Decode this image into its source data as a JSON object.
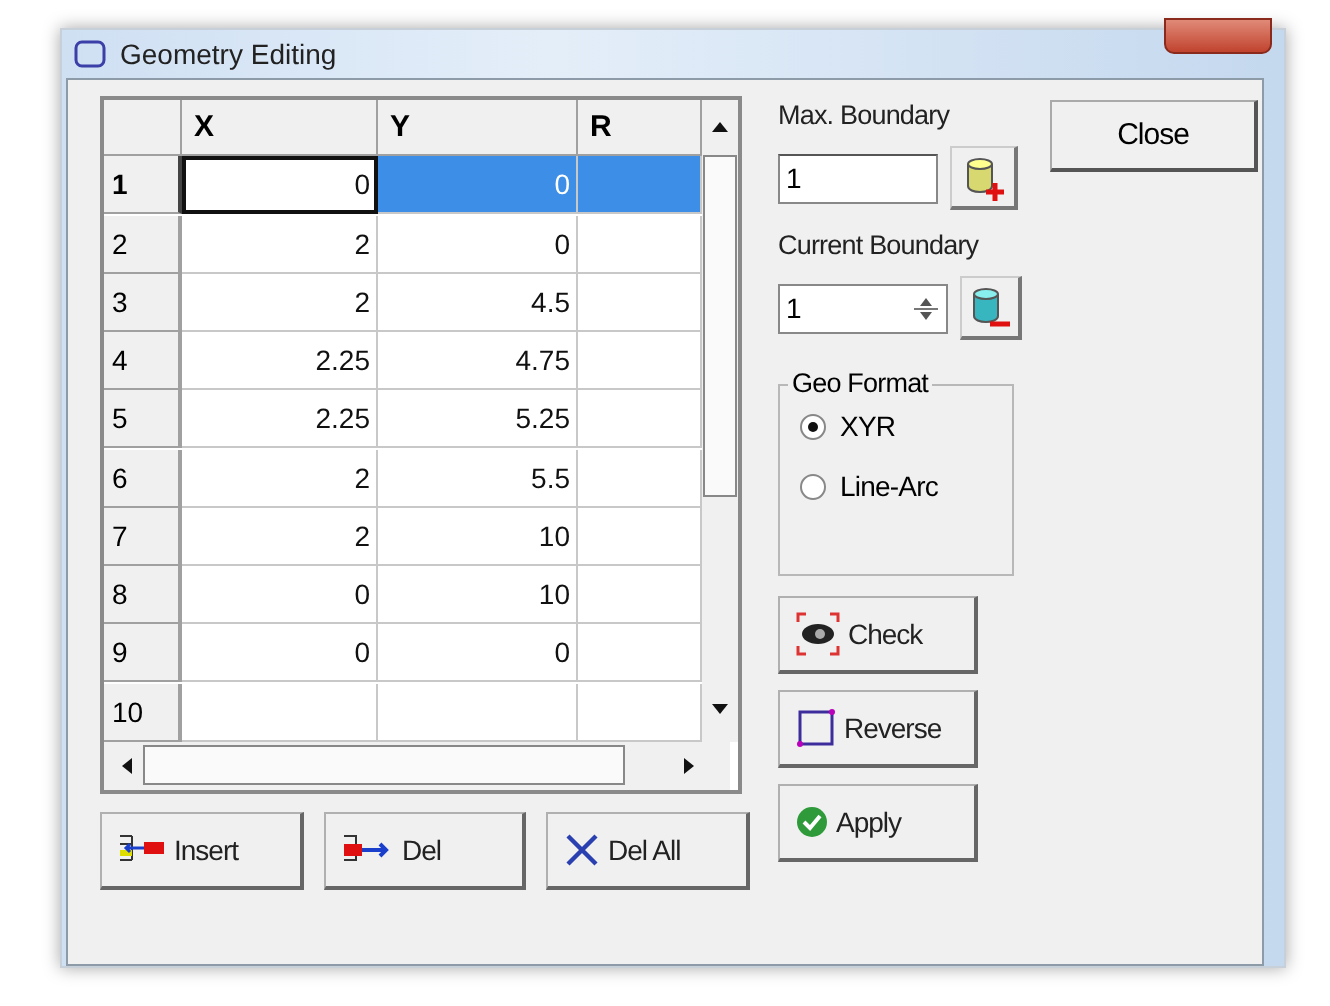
{
  "window": {
    "title": "Geometry Editing"
  },
  "grid": {
    "columns": [
      "X",
      "Y",
      "R"
    ],
    "rows": [
      {
        "header": "1",
        "selected": true,
        "cells": [
          {
            "text": "0",
            "selected": false,
            "focused": true
          },
          {
            "text": "0",
            "selected": true,
            "focused": false
          },
          {
            "text": "",
            "selected": true,
            "focused": false
          }
        ]
      },
      {
        "header": "2",
        "selected": false,
        "cells": [
          {
            "text": "2",
            "selected": false,
            "focused": false
          },
          {
            "text": "0",
            "selected": false,
            "focused": false
          },
          {
            "text": "",
            "selected": false,
            "focused": false
          }
        ]
      },
      {
        "header": "3",
        "selected": false,
        "cells": [
          {
            "text": "2",
            "selected": false,
            "focused": false
          },
          {
            "text": "4.5",
            "selected": false,
            "focused": false
          },
          {
            "text": "",
            "selected": false,
            "focused": false
          }
        ]
      },
      {
        "header": "4",
        "selected": false,
        "cells": [
          {
            "text": "2.25",
            "selected": false,
            "focused": false
          },
          {
            "text": "4.75",
            "selected": false,
            "focused": false
          },
          {
            "text": "",
            "selected": false,
            "focused": false
          }
        ]
      },
      {
        "header": "5",
        "selected": false,
        "cells": [
          {
            "text": "2.25",
            "selected": false,
            "focused": false
          },
          {
            "text": "5.25",
            "selected": false,
            "focused": false
          },
          {
            "text": "",
            "selected": false,
            "focused": false
          }
        ]
      },
      {
        "header": "6",
        "selected": false,
        "cells": [
          {
            "text": "2",
            "selected": false,
            "focused": false
          },
          {
            "text": "5.5",
            "selected": false,
            "focused": false
          },
          {
            "text": "",
            "selected": false,
            "focused": false
          }
        ]
      },
      {
        "header": "7",
        "selected": false,
        "cells": [
          {
            "text": "2",
            "selected": false,
            "focused": false
          },
          {
            "text": "10",
            "selected": false,
            "focused": false
          },
          {
            "text": "",
            "selected": false,
            "focused": false
          }
        ]
      },
      {
        "header": "8",
        "selected": false,
        "cells": [
          {
            "text": "0",
            "selected": false,
            "focused": false
          },
          {
            "text": "10",
            "selected": false,
            "focused": false
          },
          {
            "text": "",
            "selected": false,
            "focused": false
          }
        ]
      },
      {
        "header": "9",
        "selected": false,
        "cells": [
          {
            "text": "0",
            "selected": false,
            "focused": false
          },
          {
            "text": "0",
            "selected": false,
            "focused": false
          },
          {
            "text": "",
            "selected": false,
            "focused": false
          }
        ]
      },
      {
        "header": "10",
        "selected": false,
        "cells": [
          {
            "text": "",
            "selected": false,
            "focused": false
          },
          {
            "text": "",
            "selected": false,
            "focused": false
          },
          {
            "text": "",
            "selected": false,
            "focused": false
          }
        ]
      }
    ]
  },
  "grid_buttons": [
    {
      "label": "Insert",
      "kind": "insert"
    },
    {
      "label": "Del",
      "kind": "del"
    },
    {
      "label": "Del All",
      "kind": "delall"
    }
  ],
  "max_boundary": {
    "label": "Max. Boundary",
    "value": "1"
  },
  "current_boundary": {
    "label": "Current Boundary",
    "value": "1"
  },
  "geo_format": {
    "title": "Geo Format",
    "options": [
      {
        "label": "XYR",
        "selected": true
      },
      {
        "label": "Line-Arc",
        "selected": false
      }
    ]
  },
  "action_buttons": [
    {
      "label": "Check",
      "kind": "check"
    },
    {
      "label": "Reverse",
      "kind": "reverse"
    },
    {
      "label": "Apply",
      "kind": "apply"
    }
  ],
  "close_button": "Close"
}
